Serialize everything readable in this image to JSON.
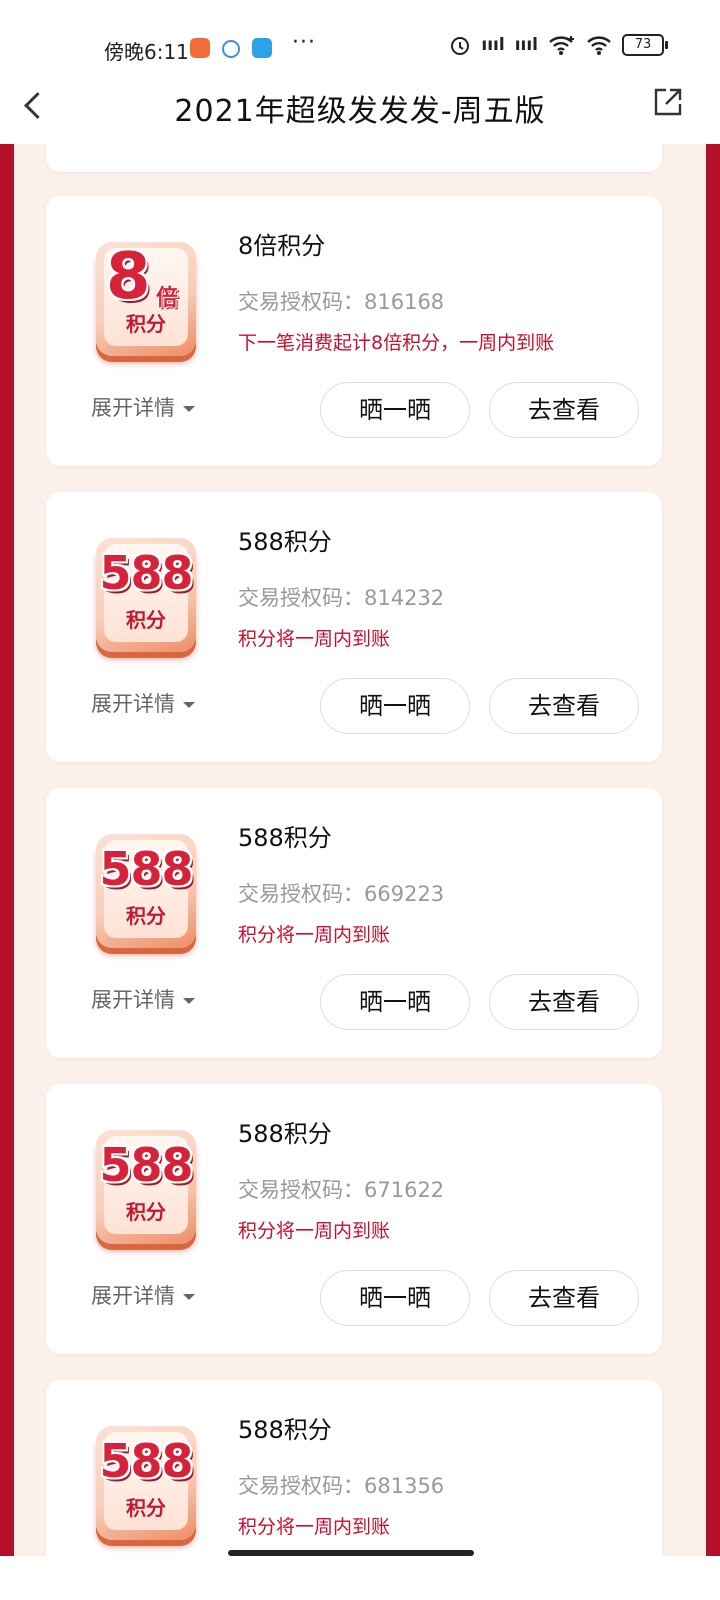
{
  "status_bar": {
    "time": "傍晚6:11",
    "dots": "···",
    "signal1": "ıııl",
    "signal2": "ıııl",
    "battery": "73"
  },
  "nav": {
    "title": "2021年超级发发发-周五版"
  },
  "cards": [
    {
      "badge_number": "8",
      "badge_suffix": "倍",
      "badge_label": "积分",
      "title": "8倍积分",
      "auth_code": "交易授权码：816168",
      "desc": "下一笔消费起计8倍积分，一周内到账",
      "expand": "展开详情",
      "share_btn": "晒一晒",
      "view_btn": "去查看"
    },
    {
      "badge_number": "588",
      "badge_label": "积分",
      "title": "588积分",
      "auth_code": "交易授权码：814232",
      "desc": "积分将一周内到账",
      "expand": "展开详情",
      "share_btn": "晒一晒",
      "view_btn": "去查看"
    },
    {
      "badge_number": "588",
      "badge_label": "积分",
      "title": "588积分",
      "auth_code": "交易授权码：669223",
      "desc": "积分将一周内到账",
      "expand": "展开详情",
      "share_btn": "晒一晒",
      "view_btn": "去查看"
    },
    {
      "badge_number": "588",
      "badge_label": "积分",
      "title": "588积分",
      "auth_code": "交易授权码：671622",
      "desc": "积分将一周内到账",
      "expand": "展开详情",
      "share_btn": "晒一晒",
      "view_btn": "去查看"
    },
    {
      "badge_number": "588",
      "badge_label": "积分",
      "title": "588积分",
      "auth_code": "交易授权码：681356",
      "desc": "积分将一周内到账"
    }
  ],
  "colors": {
    "accent_red": "#c8102e",
    "side_red": "#b4102a",
    "page_bg": "#fcf1ea"
  }
}
